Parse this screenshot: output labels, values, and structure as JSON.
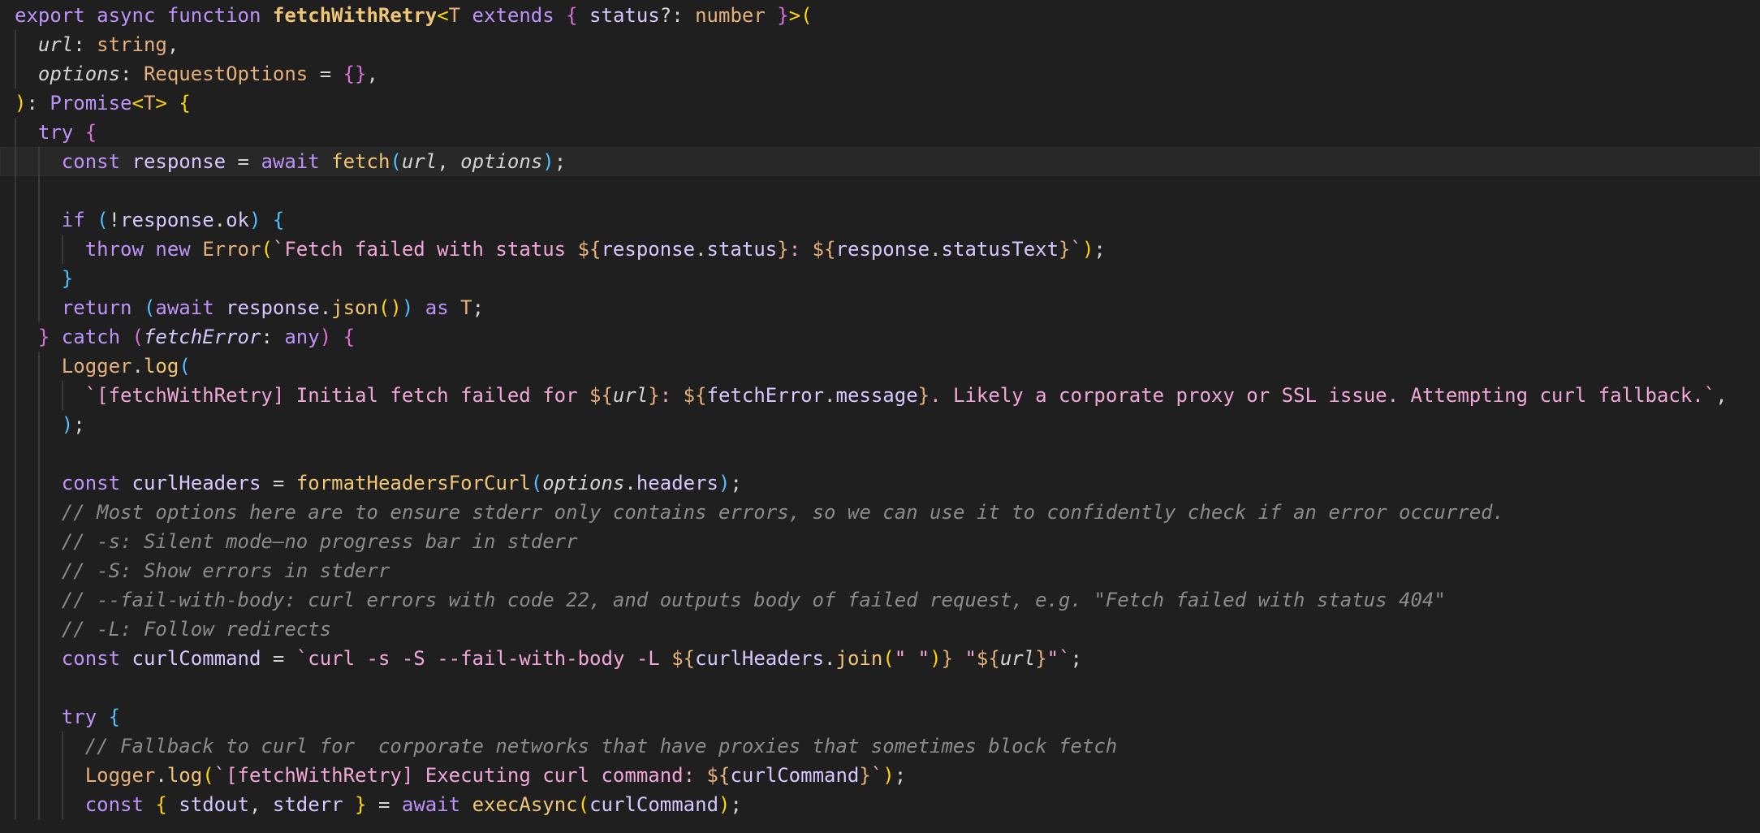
{
  "editor": {
    "language": "typescript",
    "current_line": 6,
    "lines": [
      {
        "indent": 0,
        "tokens": [
          {
            "t": "export async function ",
            "c": "#bd93f9"
          },
          {
            "t": "fetchWithRetry",
            "c": "#f0c674",
            "b": true
          },
          {
            "t": "<",
            "c": "#ffd700"
          },
          {
            "t": "T",
            "c": "#e6b07a"
          },
          {
            "t": " extends ",
            "c": "#bd93f9"
          },
          {
            "t": "{",
            "c": "#da70d6"
          },
          {
            "t": " status",
            "c": "#d6c7ff"
          },
          {
            "t": "?: ",
            "c": "#d4d4d4"
          },
          {
            "t": "number",
            "c": "#e6b07a"
          },
          {
            "t": " }",
            "c": "#da70d6"
          },
          {
            "t": ">(",
            "c": "#ffd700"
          }
        ]
      },
      {
        "indent": 1,
        "tokens": [
          {
            "t": "url",
            "c": "#d4d4d4",
            "i": true
          },
          {
            "t": ": ",
            "c": "#d4d4d4"
          },
          {
            "t": "string",
            "c": "#e6b07a"
          },
          {
            "t": ",",
            "c": "#d4d4d4"
          }
        ]
      },
      {
        "indent": 1,
        "tokens": [
          {
            "t": "options",
            "c": "#d4d4d4",
            "i": true
          },
          {
            "t": ": ",
            "c": "#d4d4d4"
          },
          {
            "t": "RequestOptions",
            "c": "#e6b07a"
          },
          {
            "t": " = ",
            "c": "#d4d4d4"
          },
          {
            "t": "{}",
            "c": "#da70d6"
          },
          {
            "t": ",",
            "c": "#d4d4d4"
          }
        ]
      },
      {
        "indent": 0,
        "tokens": [
          {
            "t": ")",
            "c": "#ffd700"
          },
          {
            "t": ": ",
            "c": "#d4d4d4"
          },
          {
            "t": "Promise",
            "c": "#bd93f9"
          },
          {
            "t": "<",
            "c": "#ffd700"
          },
          {
            "t": "T",
            "c": "#e6b07a"
          },
          {
            "t": ">",
            "c": "#ffd700"
          },
          {
            "t": " {",
            "c": "#ffd700"
          }
        ]
      },
      {
        "indent": 1,
        "tokens": [
          {
            "t": "try",
            "c": "#bd93f9"
          },
          {
            "t": " {",
            "c": "#da70d6"
          }
        ]
      },
      {
        "indent": 2,
        "tokens": [
          {
            "t": "const ",
            "c": "#bd93f9"
          },
          {
            "t": "response",
            "c": "#d6c7ff"
          },
          {
            "t": " = ",
            "c": "#d4d4d4"
          },
          {
            "t": "await ",
            "c": "#bd93f9"
          },
          {
            "t": "fetch",
            "c": "#f0c674"
          },
          {
            "t": "(",
            "c": "#4fc1ff"
          },
          {
            "t": "url",
            "c": "#d4d4d4",
            "i": true
          },
          {
            "t": ", ",
            "c": "#d4d4d4"
          },
          {
            "t": "options",
            "c": "#d4d4d4",
            "i": true
          },
          {
            "t": ")",
            "c": "#4fc1ff"
          },
          {
            "t": ";",
            "c": "#d4d4d4"
          }
        ]
      },
      {
        "indent": 2,
        "tokens": []
      },
      {
        "indent": 2,
        "tokens": [
          {
            "t": "if ",
            "c": "#bd93f9"
          },
          {
            "t": "(",
            "c": "#4fc1ff"
          },
          {
            "t": "!",
            "c": "#d4d4d4"
          },
          {
            "t": "response",
            "c": "#d6c7ff"
          },
          {
            "t": ".",
            "c": "#d4d4d4"
          },
          {
            "t": "ok",
            "c": "#d6c7ff"
          },
          {
            "t": ")",
            "c": "#4fc1ff"
          },
          {
            "t": " {",
            "c": "#4fc1ff"
          }
        ]
      },
      {
        "indent": 3,
        "tokens": [
          {
            "t": "throw new ",
            "c": "#bd93f9"
          },
          {
            "t": "Error",
            "c": "#e6b07a"
          },
          {
            "t": "(",
            "c": "#ffd700"
          },
          {
            "t": "`Fetch failed with status ",
            "c": "#f2a6d8"
          },
          {
            "t": "${",
            "c": "#e6b07a"
          },
          {
            "t": "response",
            "c": "#d6c7ff"
          },
          {
            "t": ".",
            "c": "#d4d4d4"
          },
          {
            "t": "status",
            "c": "#d6c7ff"
          },
          {
            "t": "}",
            "c": "#e6b07a"
          },
          {
            "t": ": ",
            "c": "#f2a6d8"
          },
          {
            "t": "${",
            "c": "#e6b07a"
          },
          {
            "t": "response",
            "c": "#d6c7ff"
          },
          {
            "t": ".",
            "c": "#d4d4d4"
          },
          {
            "t": "statusText",
            "c": "#d6c7ff"
          },
          {
            "t": "}",
            "c": "#e6b07a"
          },
          {
            "t": "`",
            "c": "#f2a6d8"
          },
          {
            "t": ")",
            "c": "#ffd700"
          },
          {
            "t": ";",
            "c": "#d4d4d4"
          }
        ]
      },
      {
        "indent": 2,
        "tokens": [
          {
            "t": "}",
            "c": "#4fc1ff"
          }
        ]
      },
      {
        "indent": 2,
        "tokens": [
          {
            "t": "return ",
            "c": "#bd93f9"
          },
          {
            "t": "(",
            "c": "#4fc1ff"
          },
          {
            "t": "await ",
            "c": "#bd93f9"
          },
          {
            "t": "response",
            "c": "#d6c7ff"
          },
          {
            "t": ".",
            "c": "#d4d4d4"
          },
          {
            "t": "json",
            "c": "#f0c674"
          },
          {
            "t": "()",
            "c": "#ffd700"
          },
          {
            "t": ")",
            "c": "#4fc1ff"
          },
          {
            "t": " as ",
            "c": "#bd93f9"
          },
          {
            "t": "T",
            "c": "#e6b07a"
          },
          {
            "t": ";",
            "c": "#d4d4d4"
          }
        ]
      },
      {
        "indent": 1,
        "tokens": [
          {
            "t": "} ",
            "c": "#da70d6"
          },
          {
            "t": "catch ",
            "c": "#bd93f9"
          },
          {
            "t": "(",
            "c": "#da70d6"
          },
          {
            "t": "fetchError",
            "c": "#d6c7ff",
            "i": true
          },
          {
            "t": ": ",
            "c": "#d4d4d4"
          },
          {
            "t": "any",
            "c": "#bd93f9"
          },
          {
            "t": ")",
            "c": "#da70d6"
          },
          {
            "t": " {",
            "c": "#da70d6"
          }
        ]
      },
      {
        "indent": 2,
        "tokens": [
          {
            "t": "Logger",
            "c": "#e6b07a"
          },
          {
            "t": ".",
            "c": "#d4d4d4"
          },
          {
            "t": "log",
            "c": "#f0c674"
          },
          {
            "t": "(",
            "c": "#4fc1ff"
          }
        ]
      },
      {
        "indent": 3,
        "tokens": [
          {
            "t": "`[fetchWithRetry] Initial fetch failed for ",
            "c": "#f2a6d8"
          },
          {
            "t": "${",
            "c": "#e6b07a"
          },
          {
            "t": "url",
            "c": "#d4d4d4",
            "i": true
          },
          {
            "t": "}",
            "c": "#e6b07a"
          },
          {
            "t": ": ",
            "c": "#f2a6d8"
          },
          {
            "t": "${",
            "c": "#e6b07a"
          },
          {
            "t": "fetchError",
            "c": "#d6c7ff"
          },
          {
            "t": ".",
            "c": "#d4d4d4"
          },
          {
            "t": "message",
            "c": "#d6c7ff"
          },
          {
            "t": "}",
            "c": "#e6b07a"
          },
          {
            "t": ". Likely a corporate proxy or SSL issue. Attempting curl fallback.`",
            "c": "#f2a6d8"
          },
          {
            "t": ",",
            "c": "#d4d4d4"
          }
        ]
      },
      {
        "indent": 2,
        "tokens": [
          {
            "t": ")",
            "c": "#4fc1ff"
          },
          {
            "t": ";",
            "c": "#d4d4d4"
          }
        ]
      },
      {
        "indent": 2,
        "tokens": []
      },
      {
        "indent": 2,
        "tokens": [
          {
            "t": "const ",
            "c": "#bd93f9"
          },
          {
            "t": "curlHeaders",
            "c": "#d6c7ff"
          },
          {
            "t": " = ",
            "c": "#d4d4d4"
          },
          {
            "t": "formatHeadersForCurl",
            "c": "#f0c674"
          },
          {
            "t": "(",
            "c": "#4fc1ff"
          },
          {
            "t": "options",
            "c": "#d4d4d4",
            "i": true
          },
          {
            "t": ".",
            "c": "#d4d4d4"
          },
          {
            "t": "headers",
            "c": "#d6c7ff"
          },
          {
            "t": ")",
            "c": "#4fc1ff"
          },
          {
            "t": ";",
            "c": "#d4d4d4"
          }
        ]
      },
      {
        "indent": 2,
        "tokens": [
          {
            "t": "// Most options here are to ensure stderr only contains errors, so we can use it to confidently check if an error occurred.",
            "c": "#8b8b8b",
            "i": true
          }
        ]
      },
      {
        "indent": 2,
        "tokens": [
          {
            "t": "// -s: Silent mode—no progress bar in stderr",
            "c": "#8b8b8b",
            "i": true
          }
        ]
      },
      {
        "indent": 2,
        "tokens": [
          {
            "t": "// -S: Show errors in stderr",
            "c": "#8b8b8b",
            "i": true
          }
        ]
      },
      {
        "indent": 2,
        "tokens": [
          {
            "t": "// --fail-with-body: curl errors with code 22, and outputs body of failed request, e.g. \"Fetch failed with status 404\"",
            "c": "#8b8b8b",
            "i": true
          }
        ]
      },
      {
        "indent": 2,
        "tokens": [
          {
            "t": "// -L: Follow redirects",
            "c": "#8b8b8b",
            "i": true
          }
        ]
      },
      {
        "indent": 2,
        "tokens": [
          {
            "t": "const ",
            "c": "#bd93f9"
          },
          {
            "t": "curlCommand",
            "c": "#d6c7ff"
          },
          {
            "t": " = ",
            "c": "#d4d4d4"
          },
          {
            "t": "`curl -s -S --fail-with-body -L ",
            "c": "#f2a6d8"
          },
          {
            "t": "${",
            "c": "#e6b07a"
          },
          {
            "t": "curlHeaders",
            "c": "#d6c7ff"
          },
          {
            "t": ".",
            "c": "#d4d4d4"
          },
          {
            "t": "join",
            "c": "#f0c674"
          },
          {
            "t": "(",
            "c": "#ffd700"
          },
          {
            "t": "\" \"",
            "c": "#f2a6d8"
          },
          {
            "t": ")",
            "c": "#ffd700"
          },
          {
            "t": "}",
            "c": "#e6b07a"
          },
          {
            "t": " \"",
            "c": "#f2a6d8"
          },
          {
            "t": "${",
            "c": "#e6b07a"
          },
          {
            "t": "url",
            "c": "#d4d4d4",
            "i": true
          },
          {
            "t": "}",
            "c": "#e6b07a"
          },
          {
            "t": "\"`",
            "c": "#f2a6d8"
          },
          {
            "t": ";",
            "c": "#d4d4d4"
          }
        ]
      },
      {
        "indent": 2,
        "tokens": []
      },
      {
        "indent": 2,
        "tokens": [
          {
            "t": "try",
            "c": "#bd93f9"
          },
          {
            "t": " {",
            "c": "#4fc1ff"
          }
        ]
      },
      {
        "indent": 3,
        "tokens": [
          {
            "t": "// Fallback to curl for  corporate networks that have proxies that sometimes block fetch",
            "c": "#8b8b8b",
            "i": true
          }
        ]
      },
      {
        "indent": 3,
        "tokens": [
          {
            "t": "Logger",
            "c": "#e6b07a"
          },
          {
            "t": ".",
            "c": "#d4d4d4"
          },
          {
            "t": "log",
            "c": "#f0c674"
          },
          {
            "t": "(",
            "c": "#ffd700"
          },
          {
            "t": "`[fetchWithRetry] Executing curl command: ",
            "c": "#f2a6d8"
          },
          {
            "t": "${",
            "c": "#e6b07a"
          },
          {
            "t": "curlCommand",
            "c": "#d6c7ff"
          },
          {
            "t": "}",
            "c": "#e6b07a"
          },
          {
            "t": "`",
            "c": "#f2a6d8"
          },
          {
            "t": ")",
            "c": "#ffd700"
          },
          {
            "t": ";",
            "c": "#d4d4d4"
          }
        ]
      },
      {
        "indent": 3,
        "tokens": [
          {
            "t": "const ",
            "c": "#bd93f9"
          },
          {
            "t": "{",
            "c": "#ffd700"
          },
          {
            "t": " stdout",
            "c": "#d6c7ff"
          },
          {
            "t": ", ",
            "c": "#d4d4d4"
          },
          {
            "t": "stderr",
            "c": "#d6c7ff"
          },
          {
            "t": " }",
            "c": "#ffd700"
          },
          {
            "t": " = ",
            "c": "#d4d4d4"
          },
          {
            "t": "await ",
            "c": "#bd93f9"
          },
          {
            "t": "execAsync",
            "c": "#f0c674"
          },
          {
            "t": "(",
            "c": "#ffd700"
          },
          {
            "t": "curlCommand",
            "c": "#d6c7ff"
          },
          {
            "t": ")",
            "c": "#ffd700"
          },
          {
            "t": ";",
            "c": "#d4d4d4"
          }
        ]
      }
    ]
  }
}
